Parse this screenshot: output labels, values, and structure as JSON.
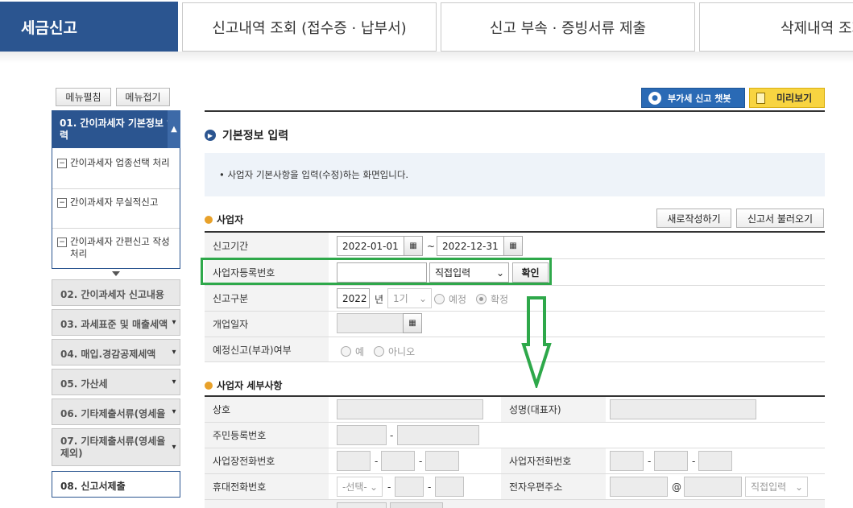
{
  "tabs": {
    "active": "세금신고",
    "items": [
      "신고내역 조회 (접수증 · 납부서)",
      "신고 부속 · 증빙서류 제출",
      "삭제내역 조회"
    ]
  },
  "left": {
    "expand_all": "메뉴펼침",
    "collapse_all": "메뉴접기",
    "open_menu": {
      "label": "01. 간이과세자 기본정보 입력",
      "subitems": [
        "간이과세자 업종선택 처리",
        "간이과세자 무실적신고",
        "간이과세자 간편신고 작성 처리"
      ]
    },
    "menu_items": [
      {
        "label": "02. 간이과세자 신고내용"
      },
      {
        "label": "03. 과세표준 및 매출세액"
      },
      {
        "label": "04. 매입.경감공제세액"
      },
      {
        "label": "05. 가산세"
      },
      {
        "label": "06. 기타제출서류(영세율"
      },
      {
        "label": "07. 기타제출서류(영세율 제외)"
      },
      {
        "label": "08. 신고서제출"
      }
    ]
  },
  "toolbar": {
    "chatbot": "부가세 신고 챗봇",
    "preview": "미리보기"
  },
  "main": {
    "title": "기본정보 입력",
    "info": "사업자 기본사항을 입력(수정)하는 화면입니다.",
    "section1": {
      "title": "사업자",
      "new_btn": "새로작성하기",
      "load_btn": "신고서 불러오기",
      "period_label": "신고기간",
      "date_from": "2022-01-01",
      "tilde": "~",
      "date_to": "2022-12-31",
      "bizno_label": "사업자등록번호",
      "bizno_value": "",
      "input_mode": "직접입력",
      "confirm": "확인",
      "type_label": "신고구분",
      "year": "2022",
      "year_unit": "년",
      "term": "1기",
      "radio_planned": "예정",
      "radio_final": "확정",
      "open_date_label": "개업일자",
      "prelim_label": "예정신고(부과)여부",
      "radio_yes": "예",
      "radio_no": "아니오"
    },
    "section2": {
      "title": "사업자 세부사항",
      "company_label": "상호",
      "ceo_label": "성명(대표자)",
      "rrn_label": "주민등록번호",
      "shop_phone_label": "사업장전화번호",
      "biz_phone_label": "사업자전화번호",
      "mobile_label": "휴대전화번호",
      "mobile_select": "-선택-",
      "email_label": "전자우편주소",
      "email_mode": "직접입력",
      "dash": "-",
      "at": "@"
    }
  },
  "annotation_color": "#2ea84a"
}
